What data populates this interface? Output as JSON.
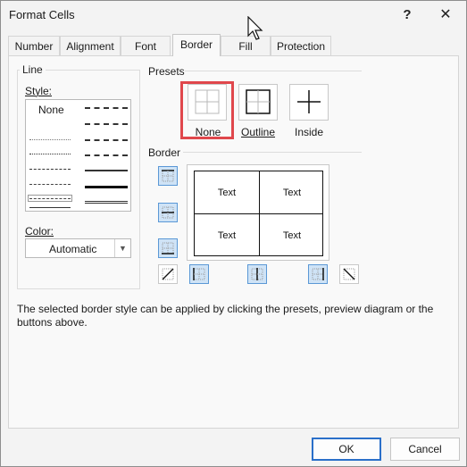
{
  "window": {
    "title": "Format Cells",
    "help_glyph": "?",
    "close_glyph": "✕"
  },
  "tabs": [
    {
      "label": "Number",
      "active": false
    },
    {
      "label": "Alignment",
      "active": false
    },
    {
      "label": "Font",
      "active": false
    },
    {
      "label": "Border",
      "active": true
    },
    {
      "label": "Fill",
      "active": false
    },
    {
      "label": "Protection",
      "active": false
    }
  ],
  "line": {
    "legend": "Line",
    "style_label": "Style:",
    "style_none": "None",
    "color_label": "Color:",
    "color_value": "Automatic"
  },
  "presets": {
    "legend": "Presets",
    "none_label": "None",
    "outline_label": "Outline",
    "inside_label": "Inside"
  },
  "border": {
    "legend": "Border",
    "cell_texts": [
      "Text",
      "Text",
      "Text",
      "Text"
    ]
  },
  "description": "The selected border style can be applied by clicking the presets, preview diagram or the buttons above.",
  "footer": {
    "ok_label": "OK",
    "cancel_label": "Cancel"
  },
  "colors": {
    "highlight": "#e0474c",
    "button_selected": "#cfe3f6",
    "button_border": "#5b98d6",
    "ok_border": "#2a6fc9"
  }
}
